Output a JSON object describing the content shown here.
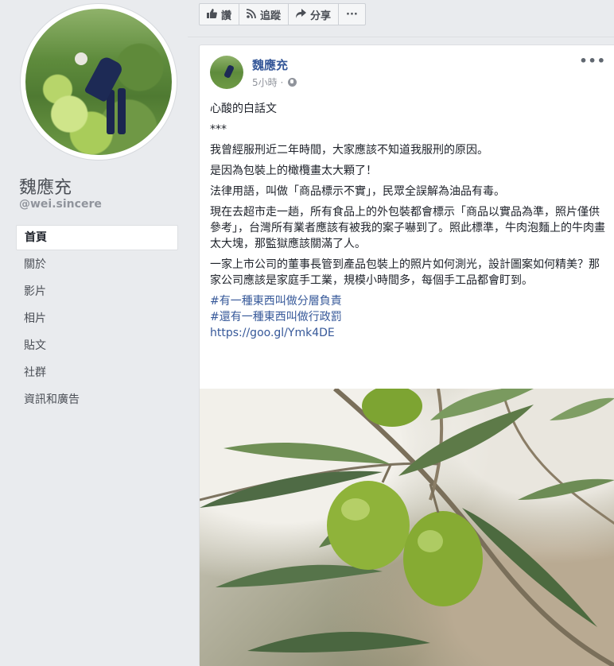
{
  "profile": {
    "name": "魏應充",
    "handle": "@wei.sincere"
  },
  "nav": {
    "items": [
      {
        "label": "首頁",
        "active": true
      },
      {
        "label": "關於"
      },
      {
        "label": "影片"
      },
      {
        "label": "相片"
      },
      {
        "label": "貼文"
      },
      {
        "label": "社群"
      },
      {
        "label": "資訊和廣告"
      }
    ]
  },
  "actions": {
    "like": "讚",
    "follow": "追蹤",
    "share": "分享",
    "more": "···"
  },
  "post": {
    "author": "魏應充",
    "time": "5小時",
    "title": "心酸的白話文",
    "separator": "***",
    "paragraphs": [
      "我曾經服刑近二年時間，大家應該不知道我服刑的原因。",
      "是因為包裝上的橄欖畫太大顆了！",
      "法律用語，叫做「商品標示不實」，民眾全誤解為油品有毒。",
      "現在去超市走一趟，所有食品上的外包裝都會標示「商品以實品為準，照片僅供參考」，台灣所有業者應該有被我的案子嚇到了。照此標準，牛肉泡麵上的牛肉畫太大塊，那監獄應該關滿了人。",
      "一家上市公司的董事長管到產品包裝上的照片如何測光，設計圖案如何精美？那家公司應該是家庭手工業，規模小時間多，每個手工品都會盯到。"
    ],
    "hashtags": [
      "#有一種東西叫做分層負責",
      "#還有一種東西叫做行政罰"
    ],
    "url": "https://goo.gl/Ymk4DE",
    "image_icon": "olive-branch-photo"
  },
  "colors": {
    "link": "#365899",
    "background": "#e9ebee",
    "olive": "#8fb33a"
  }
}
